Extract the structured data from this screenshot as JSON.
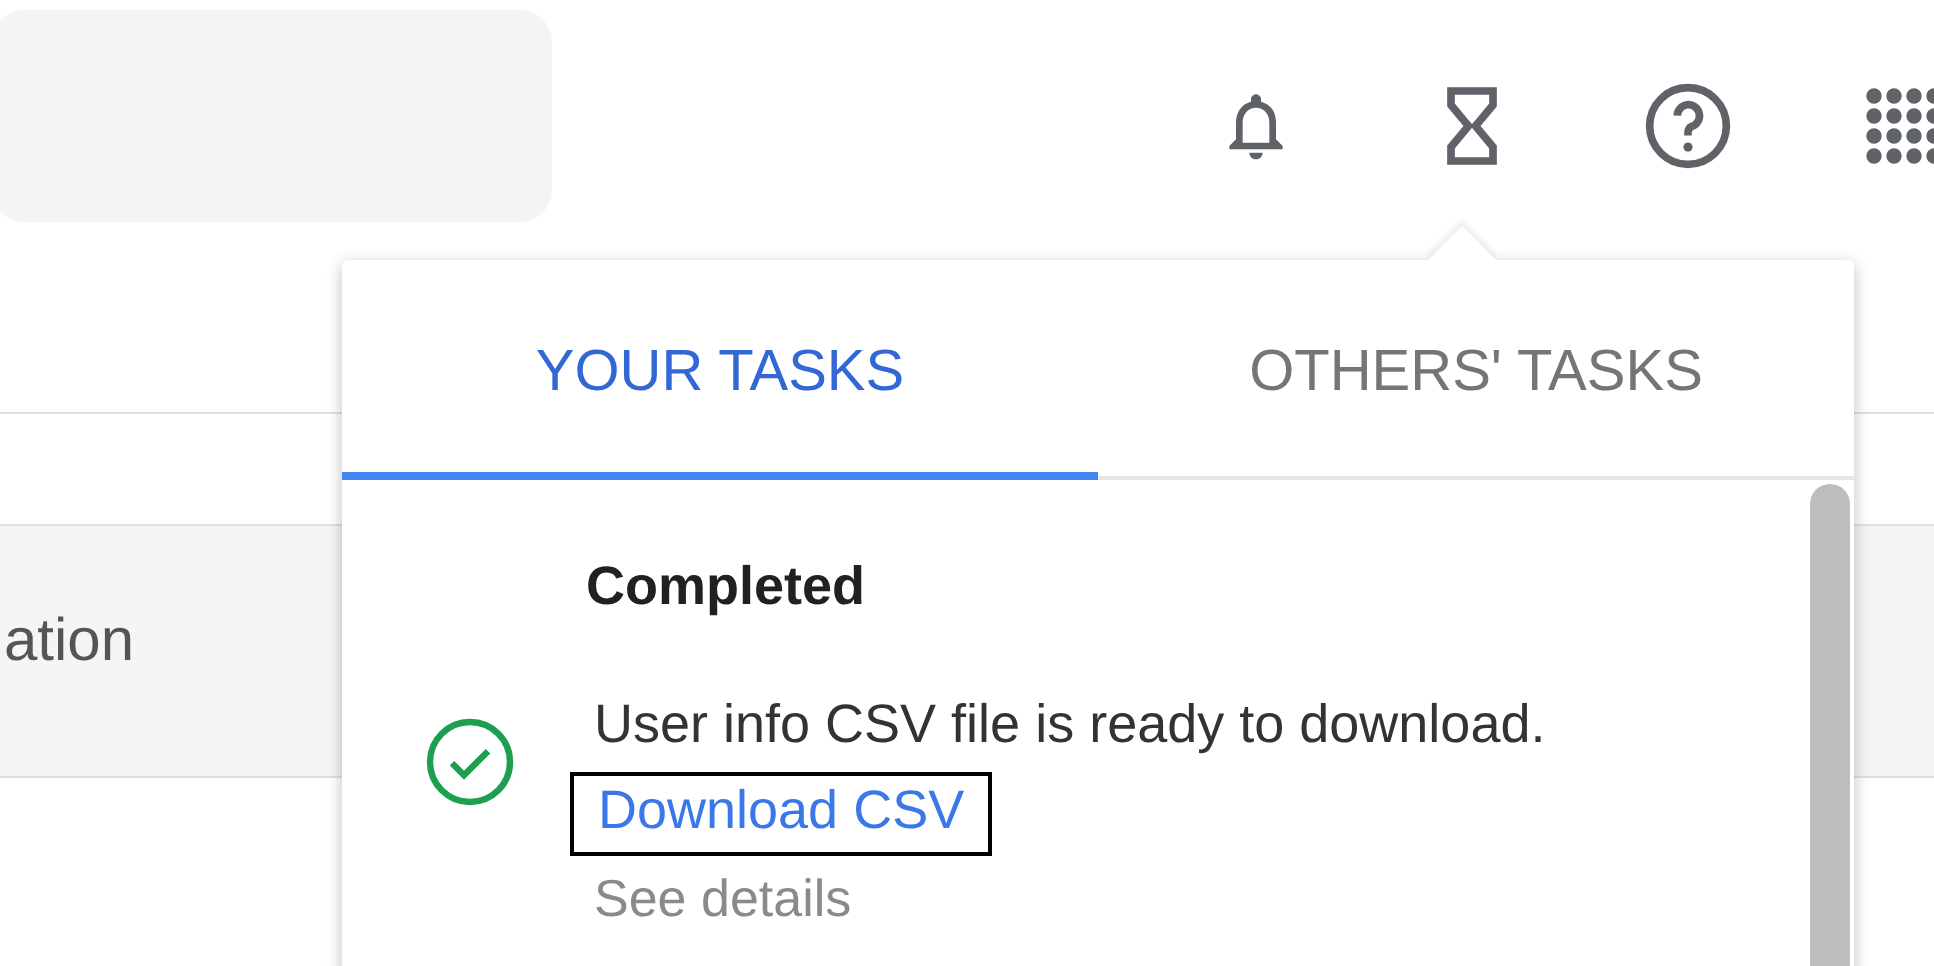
{
  "table": {
    "header_cell": "ation"
  },
  "tasks_popover": {
    "tabs": [
      {
        "label": "YOUR TASKS",
        "selected": true
      },
      {
        "label": "OTHERS' TASKS",
        "selected": false
      }
    ],
    "section_title": "Completed",
    "tasks": [
      {
        "completed": true,
        "message": "User info CSV file is ready to download.",
        "link": {
          "label": "Download CSV",
          "focused": true
        },
        "details": "See details"
      }
    ]
  }
}
